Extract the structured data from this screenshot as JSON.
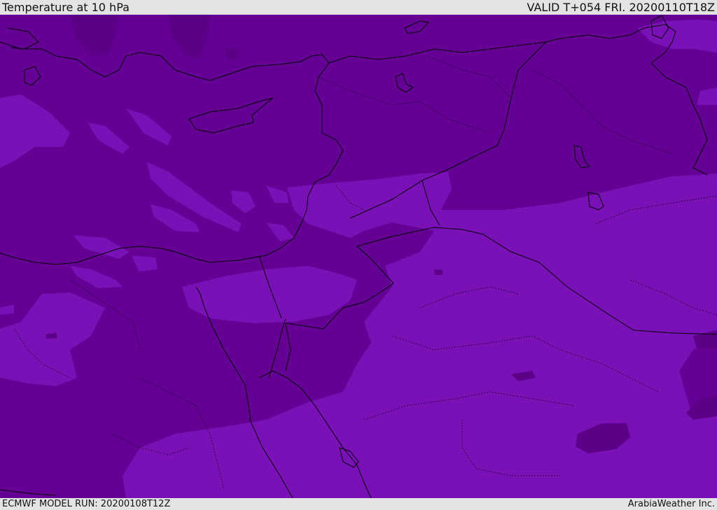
{
  "header": {
    "title": "Temperature at 10 hPa",
    "valid": "VALID T+054 FRI. 20200110T18Z"
  },
  "footer": {
    "model_run": "ECMWF MODEL RUN: 20200108T12Z",
    "credit": "ArabiaWeather Inc."
  },
  "colors": {
    "dark": "#650095",
    "mid": "#6e00a3",
    "light": "#7a11b6",
    "bar": "#e4e4e4"
  }
}
